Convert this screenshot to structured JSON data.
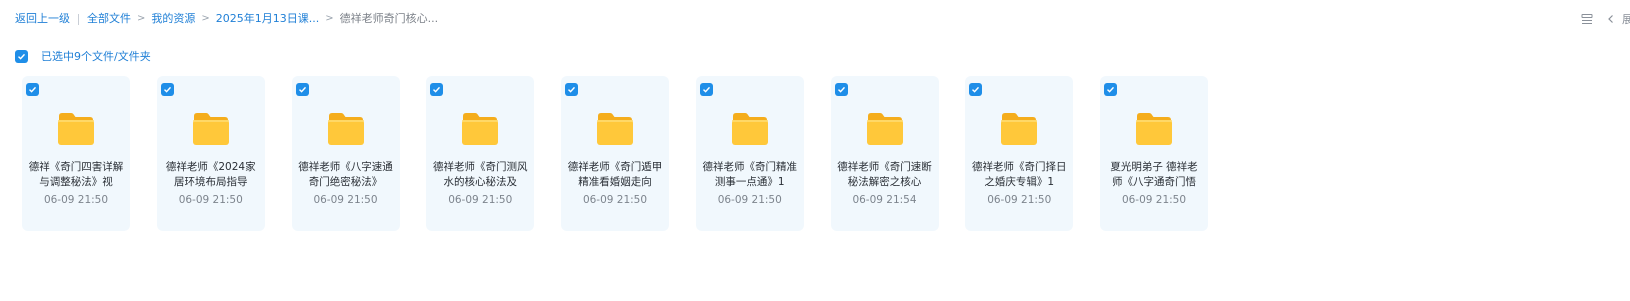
{
  "breadcrumb": {
    "back": "返回上一级",
    "items": [
      "全部文件",
      "我的资源",
      "2025年1月13日课...",
      "德祥老师奇门核心..."
    ]
  },
  "toolbar": {
    "list_view_icon": "list-view-icon",
    "prev_icon": "chevron-left-icon",
    "cut_text": "展"
  },
  "selection": {
    "text": "已选中9个文件/文件夹",
    "checked": true
  },
  "colors": {
    "accent": "#1f8ee8",
    "link": "#1f7fd6",
    "tile_bg": "#f1f8fd",
    "folder": "#ffc42e"
  },
  "files": [
    {
      "name": "德祥《奇门四害详解与调整秘法》视",
      "date": "06-09 21:50",
      "checked": true
    },
    {
      "name": "德祥老师《2024家居环境布局指导",
      "date": "06-09 21:50",
      "checked": true
    },
    {
      "name": "德祥老师《八字速通奇门绝密秘法》",
      "date": "06-09 21:50",
      "checked": true
    },
    {
      "name": "德祥老师《奇门测风水的核心秘法及",
      "date": "06-09 21:50",
      "checked": true
    },
    {
      "name": "德祥老师《奇门遁甲精准看婚姻走向",
      "date": "06-09 21:50",
      "checked": true
    },
    {
      "name": "德祥老师《奇门精准测事一点通》1",
      "date": "06-09 21:50",
      "checked": true
    },
    {
      "name": "德祥老师《奇门速断秘法解密之核心",
      "date": "06-09 21:54",
      "checked": true
    },
    {
      "name": "德祥老师《奇门择日之婚庆专辑》1",
      "date": "06-09 21:50",
      "checked": true
    },
    {
      "name": "夏光明弟子 德祥老师《八字通奇门悟",
      "date": "06-09 21:50",
      "checked": true
    }
  ]
}
